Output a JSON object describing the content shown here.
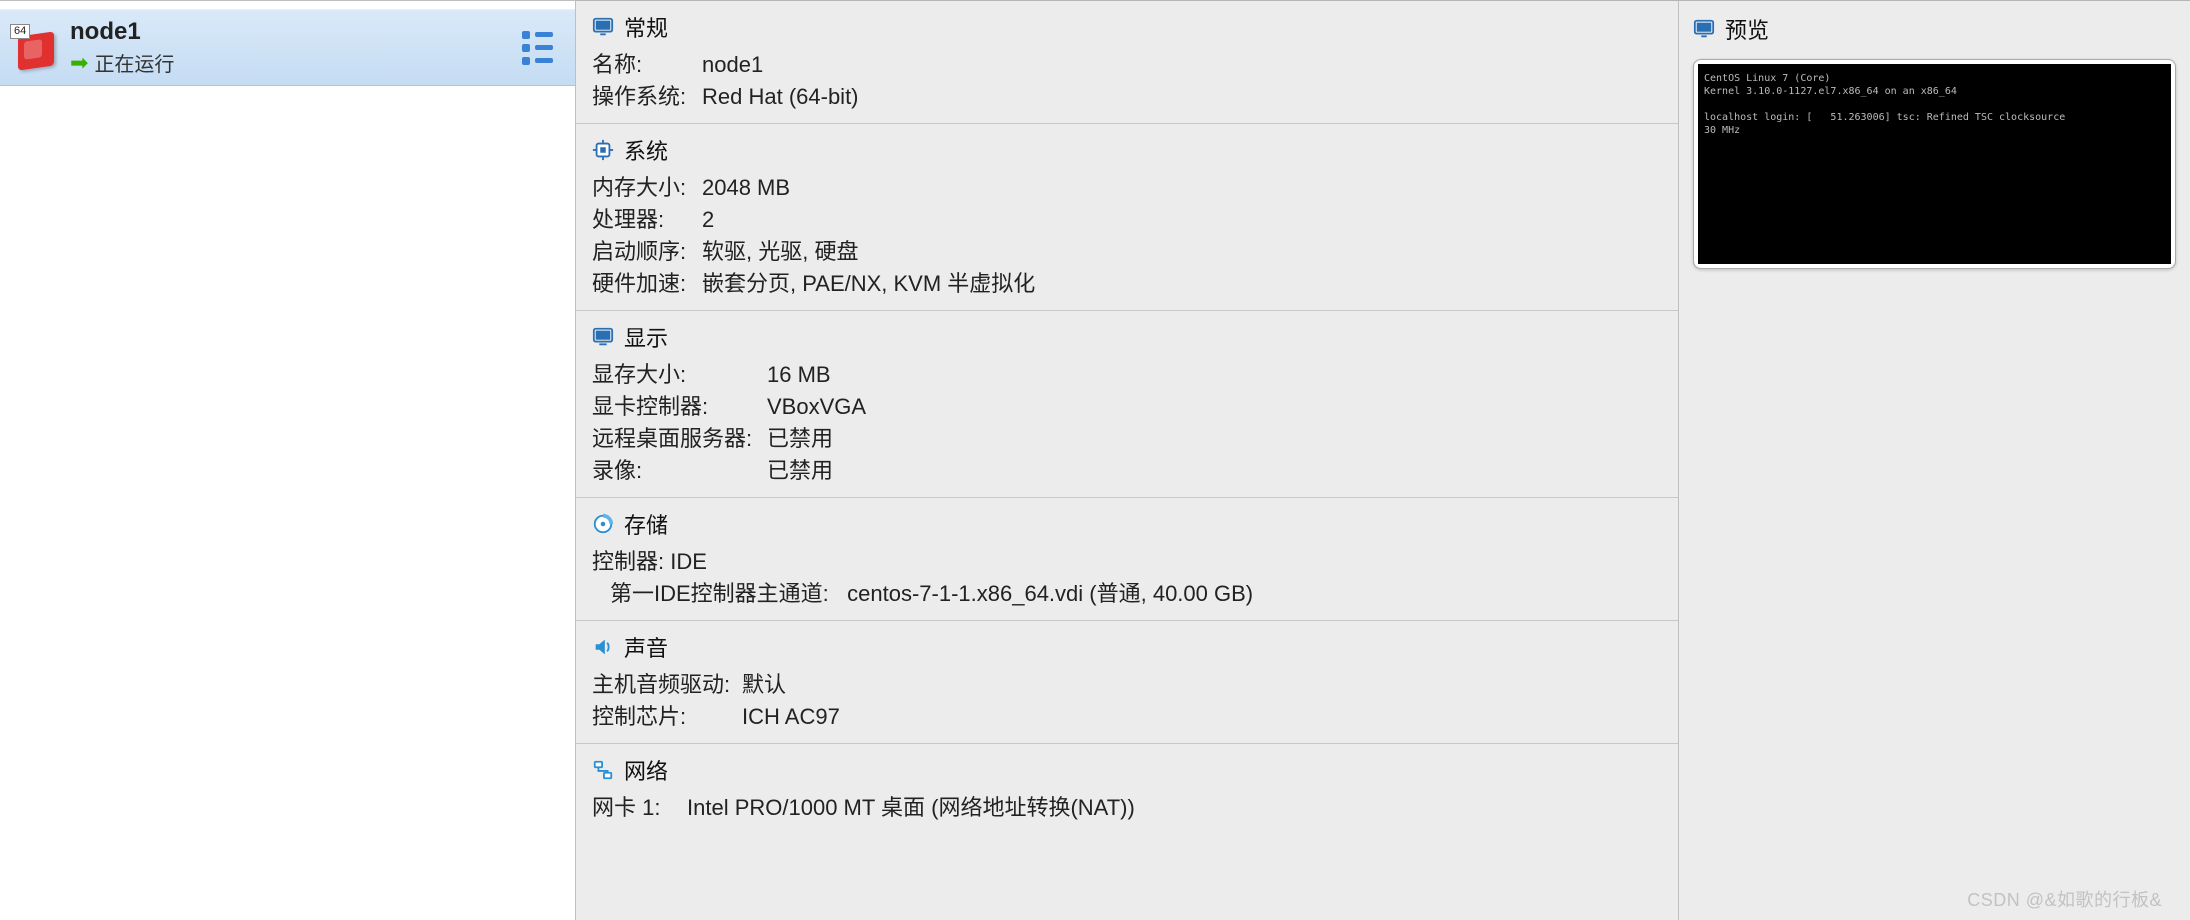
{
  "sidebar": {
    "vm": {
      "name": "node1",
      "status": "正在运行",
      "arch_badge": "64"
    }
  },
  "details": {
    "general": {
      "title": "常规",
      "name_label": "名称:",
      "name_value": "node1",
      "os_label": "操作系统:",
      "os_value": "Red Hat (64-bit)"
    },
    "system": {
      "title": "系统",
      "memory_label": "内存大小:",
      "memory_value": "2048 MB",
      "cpu_label": "处理器:",
      "cpu_value": "2",
      "boot_label": "启动顺序:",
      "boot_value": "软驱, 光驱, 硬盘",
      "accel_label": "硬件加速:",
      "accel_value": "嵌套分页, PAE/NX, KVM 半虚拟化"
    },
    "display": {
      "title": "显示",
      "vram_label": "显存大小:",
      "vram_value": "16 MB",
      "controller_label": "显卡控制器:",
      "controller_value": "VBoxVGA",
      "rdp_label": "远程桌面服务器:",
      "rdp_value": "已禁用",
      "record_label": "录像:",
      "record_value": "已禁用"
    },
    "storage": {
      "title": "存储",
      "controller_label": "控制器: IDE",
      "slot_label": "第一IDE控制器主通道:",
      "slot_value": "centos-7-1-1.x86_64.vdi (普通, 40.00 GB)"
    },
    "audio": {
      "title": "声音",
      "driver_label": "主机音频驱动:",
      "driver_value": "默认",
      "chip_label": "控制芯片:",
      "chip_value": "ICH AC97"
    },
    "network": {
      "title": "网络",
      "nic_label": "网卡 1:",
      "nic_value": "Intel PRO/1000 MT 桌面 (网络地址转换(NAT))"
    }
  },
  "preview": {
    "title": "预览",
    "console_text": "CentOS Linux 7 (Core)\nKernel 3.10.0-1127.el7.x86_64 on an x86_64\n\nlocalhost login: [   51.263006] tsc: Refined TSC clocksource\n30 MHz"
  },
  "watermark": "CSDN @&如歌的行板&"
}
